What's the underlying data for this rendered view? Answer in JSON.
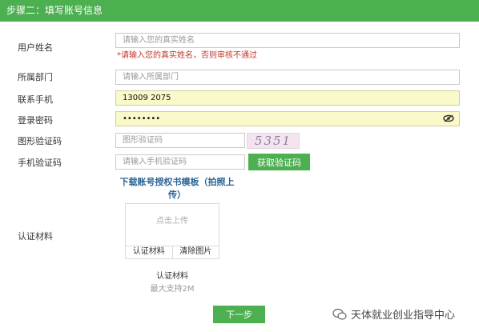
{
  "header": {
    "title": "步骤二：填写账号信息"
  },
  "form": {
    "name_label": "用户姓名",
    "name_placeholder": "请输入您的真实姓名",
    "name_error": "*请输入您的真实姓名，否则审核不通过",
    "dept_label": "所属部门",
    "dept_placeholder": "请输入所属部门",
    "phone_label": "联系手机",
    "phone_value": "13009 2075",
    "password_label": "登录密码",
    "password_value": "••••••••",
    "captcha_label": "图形验证码",
    "captcha_placeholder": "图形验证码",
    "captcha_image_text": "5351",
    "sms_label": "手机验证码",
    "sms_placeholder": "请输入手机验证码",
    "sms_button": "获取验证码",
    "download_link": "下载账号授权书模板（拍照上传）",
    "material_label": "认证材料",
    "upload_hint": "点击上传",
    "upload_action_material": "认证材料",
    "upload_action_clear": "清除图片",
    "upload_caption": "认证材料",
    "upload_limit": "最大支持2M",
    "next_button": "下一步"
  },
  "watermark": {
    "text": "天体就业创业指导中心"
  },
  "colors": {
    "accent": "#4caf50",
    "error": "#c0392b",
    "link": "#2a6496",
    "filled_bg": "#f9f9c9"
  }
}
